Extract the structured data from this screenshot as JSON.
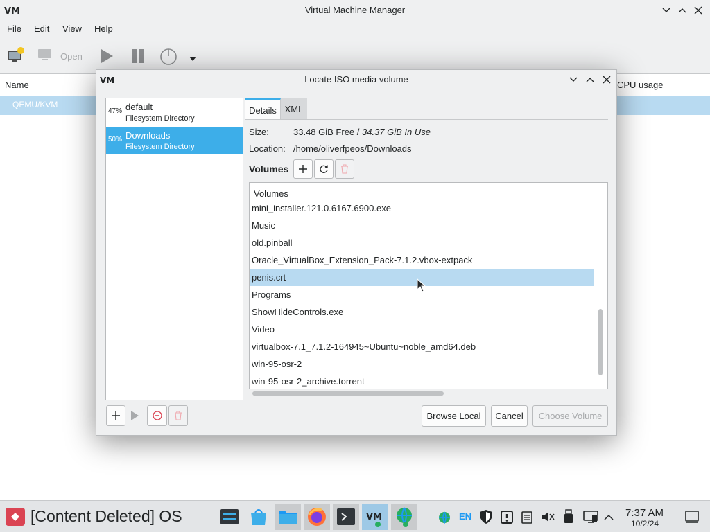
{
  "app": {
    "title": "Virtual Machine Manager",
    "menu": [
      "File",
      "Edit",
      "View",
      "Help"
    ],
    "toolbar": {
      "open_label": "Open"
    },
    "list_headers": {
      "name": "Name",
      "cpu": "CPU usage"
    },
    "vm_row": "QEMU/KVM"
  },
  "dialog": {
    "title": "Locate ISO media volume",
    "pools": [
      {
        "percent": "47%",
        "name": "default",
        "type": "Filesystem Directory"
      },
      {
        "percent": "50%",
        "name": "Downloads",
        "type": "Filesystem Directory"
      }
    ],
    "tabs": [
      "Details",
      "XML"
    ],
    "size_label": "Size:",
    "size_free": "33.48 GiB Free / ",
    "size_used": "34.37 GiB In Use",
    "location_label": "Location:",
    "location_value": "/home/oliverfpeos/Downloads",
    "volumes_label": "Volumes",
    "volumes_column": "Volumes",
    "volumes": [
      "mini_installer.121.0.6167.6900.exe",
      "Music",
      "old.pinball",
      "Oracle_VirtualBox_Extension_Pack-7.1.2.vbox-extpack",
      "penis.crt",
      "Programs",
      "ShowHideControls.exe",
      "Video",
      "virtualbox-7.1_7.1.2-164945~Ubuntu~noble_amd64.deb",
      "win-95-osr-2",
      "win-95-osr-2_archive.torrent"
    ],
    "selected_volume": "penis.crt",
    "buttons": {
      "browse": "Browse Local",
      "cancel": "Cancel",
      "choose": "Choose Volume"
    }
  },
  "taskbar": {
    "start_label": "[Content Deleted] OS",
    "lang": "EN",
    "time": "7:37 AM",
    "date": "10/2/24"
  },
  "colors": {
    "selection": "#3daee9",
    "row_highlight": "#b8daf1",
    "start_red": "#da4453"
  }
}
